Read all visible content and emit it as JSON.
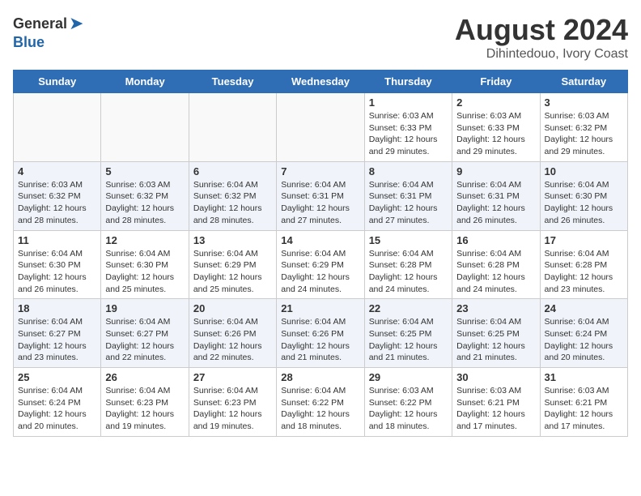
{
  "header": {
    "logo_general": "General",
    "logo_blue": "Blue",
    "month_title": "August 2024",
    "location": "Dihintedouo, Ivory Coast"
  },
  "days_of_week": [
    "Sunday",
    "Monday",
    "Tuesday",
    "Wednesday",
    "Thursday",
    "Friday",
    "Saturday"
  ],
  "weeks": [
    [
      {
        "day": "",
        "info": ""
      },
      {
        "day": "",
        "info": ""
      },
      {
        "day": "",
        "info": ""
      },
      {
        "day": "",
        "info": ""
      },
      {
        "day": "1",
        "info": "Sunrise: 6:03 AM\nSunset: 6:33 PM\nDaylight: 12 hours\nand 29 minutes."
      },
      {
        "day": "2",
        "info": "Sunrise: 6:03 AM\nSunset: 6:33 PM\nDaylight: 12 hours\nand 29 minutes."
      },
      {
        "day": "3",
        "info": "Sunrise: 6:03 AM\nSunset: 6:32 PM\nDaylight: 12 hours\nand 29 minutes."
      }
    ],
    [
      {
        "day": "4",
        "info": "Sunrise: 6:03 AM\nSunset: 6:32 PM\nDaylight: 12 hours\nand 28 minutes."
      },
      {
        "day": "5",
        "info": "Sunrise: 6:03 AM\nSunset: 6:32 PM\nDaylight: 12 hours\nand 28 minutes."
      },
      {
        "day": "6",
        "info": "Sunrise: 6:04 AM\nSunset: 6:32 PM\nDaylight: 12 hours\nand 28 minutes."
      },
      {
        "day": "7",
        "info": "Sunrise: 6:04 AM\nSunset: 6:31 PM\nDaylight: 12 hours\nand 27 minutes."
      },
      {
        "day": "8",
        "info": "Sunrise: 6:04 AM\nSunset: 6:31 PM\nDaylight: 12 hours\nand 27 minutes."
      },
      {
        "day": "9",
        "info": "Sunrise: 6:04 AM\nSunset: 6:31 PM\nDaylight: 12 hours\nand 26 minutes."
      },
      {
        "day": "10",
        "info": "Sunrise: 6:04 AM\nSunset: 6:30 PM\nDaylight: 12 hours\nand 26 minutes."
      }
    ],
    [
      {
        "day": "11",
        "info": "Sunrise: 6:04 AM\nSunset: 6:30 PM\nDaylight: 12 hours\nand 26 minutes."
      },
      {
        "day": "12",
        "info": "Sunrise: 6:04 AM\nSunset: 6:30 PM\nDaylight: 12 hours\nand 25 minutes."
      },
      {
        "day": "13",
        "info": "Sunrise: 6:04 AM\nSunset: 6:29 PM\nDaylight: 12 hours\nand 25 minutes."
      },
      {
        "day": "14",
        "info": "Sunrise: 6:04 AM\nSunset: 6:29 PM\nDaylight: 12 hours\nand 24 minutes."
      },
      {
        "day": "15",
        "info": "Sunrise: 6:04 AM\nSunset: 6:28 PM\nDaylight: 12 hours\nand 24 minutes."
      },
      {
        "day": "16",
        "info": "Sunrise: 6:04 AM\nSunset: 6:28 PM\nDaylight: 12 hours\nand 24 minutes."
      },
      {
        "day": "17",
        "info": "Sunrise: 6:04 AM\nSunset: 6:28 PM\nDaylight: 12 hours\nand 23 minutes."
      }
    ],
    [
      {
        "day": "18",
        "info": "Sunrise: 6:04 AM\nSunset: 6:27 PM\nDaylight: 12 hours\nand 23 minutes."
      },
      {
        "day": "19",
        "info": "Sunrise: 6:04 AM\nSunset: 6:27 PM\nDaylight: 12 hours\nand 22 minutes."
      },
      {
        "day": "20",
        "info": "Sunrise: 6:04 AM\nSunset: 6:26 PM\nDaylight: 12 hours\nand 22 minutes."
      },
      {
        "day": "21",
        "info": "Sunrise: 6:04 AM\nSunset: 6:26 PM\nDaylight: 12 hours\nand 21 minutes."
      },
      {
        "day": "22",
        "info": "Sunrise: 6:04 AM\nSunset: 6:25 PM\nDaylight: 12 hours\nand 21 minutes."
      },
      {
        "day": "23",
        "info": "Sunrise: 6:04 AM\nSunset: 6:25 PM\nDaylight: 12 hours\nand 21 minutes."
      },
      {
        "day": "24",
        "info": "Sunrise: 6:04 AM\nSunset: 6:24 PM\nDaylight: 12 hours\nand 20 minutes."
      }
    ],
    [
      {
        "day": "25",
        "info": "Sunrise: 6:04 AM\nSunset: 6:24 PM\nDaylight: 12 hours\nand 20 minutes."
      },
      {
        "day": "26",
        "info": "Sunrise: 6:04 AM\nSunset: 6:23 PM\nDaylight: 12 hours\nand 19 minutes."
      },
      {
        "day": "27",
        "info": "Sunrise: 6:04 AM\nSunset: 6:23 PM\nDaylight: 12 hours\nand 19 minutes."
      },
      {
        "day": "28",
        "info": "Sunrise: 6:04 AM\nSunset: 6:22 PM\nDaylight: 12 hours\nand 18 minutes."
      },
      {
        "day": "29",
        "info": "Sunrise: 6:03 AM\nSunset: 6:22 PM\nDaylight: 12 hours\nand 18 minutes."
      },
      {
        "day": "30",
        "info": "Sunrise: 6:03 AM\nSunset: 6:21 PM\nDaylight: 12 hours\nand 17 minutes."
      },
      {
        "day": "31",
        "info": "Sunrise: 6:03 AM\nSunset: 6:21 PM\nDaylight: 12 hours\nand 17 minutes."
      }
    ]
  ]
}
